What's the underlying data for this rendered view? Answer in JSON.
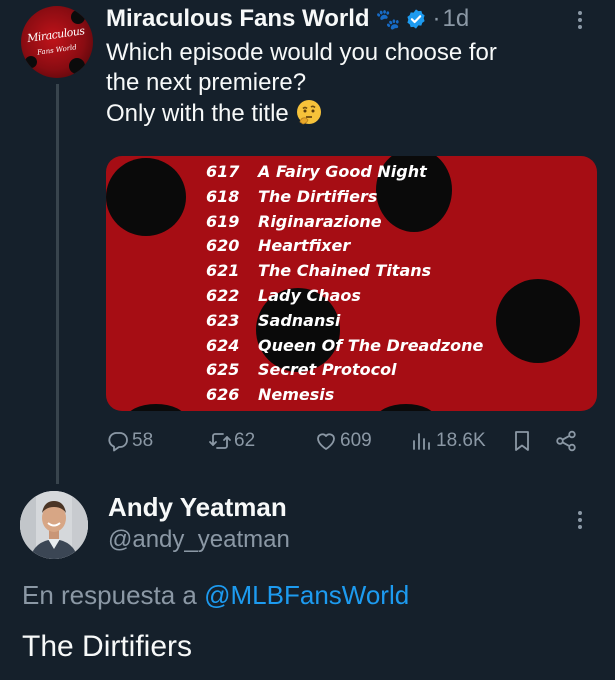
{
  "tweet": {
    "avatar_lines": [
      "Miraculous",
      "Fans World"
    ],
    "display_name": "Miraculous Fans World",
    "badge_emoji": "🐾",
    "verified_icon": "verified-badge-icon",
    "separator": "·",
    "time": "1d",
    "text_lines": [
      "Which episode would you choose for",
      "the next premiere?",
      "Only with the title"
    ],
    "thinking_emoji_icon": "thinking-face-icon",
    "episodes": [
      {
        "num": "617",
        "title": "A Fairy Good Night"
      },
      {
        "num": "618",
        "title": "The Dirtifiers"
      },
      {
        "num": "619",
        "title": "Riginarazione"
      },
      {
        "num": "620",
        "title": "Heartfixer"
      },
      {
        "num": "621",
        "title": "The Chained Titans"
      },
      {
        "num": "622",
        "title": "Lady Chaos"
      },
      {
        "num": "623",
        "title": "Sadnansi"
      },
      {
        "num": "624",
        "title": "Queen Of The Dreadzone"
      },
      {
        "num": "625",
        "title": "Secret Protocol"
      },
      {
        "num": "626",
        "title": "Nemesis"
      }
    ],
    "actions": {
      "replies": "58",
      "reposts": "62",
      "likes": "609",
      "views": "18.6K"
    },
    "colors": {
      "accent": "#1d9bf0",
      "media_bg": "#a60d14",
      "muted": "#8b98a5"
    }
  },
  "reply": {
    "display_name": "Andy Yeatman",
    "handle": "@andy_yeatman",
    "reply_prefix": "En respuesta a ",
    "mention": "@MLBFansWorld",
    "text": "The Dirtifiers"
  }
}
